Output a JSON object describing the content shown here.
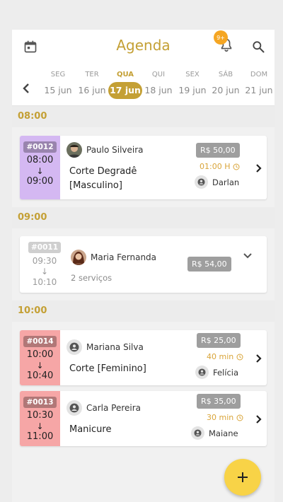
{
  "header": {
    "title": "Agenda",
    "notification_badge": "9+",
    "calendar_icon": "calendar-icon",
    "bell_icon": "bell-icon",
    "search_icon": "search-icon"
  },
  "week": {
    "days": [
      {
        "weekday": "SEG",
        "date": "15 jun"
      },
      {
        "weekday": "TER",
        "date": "16 jun"
      },
      {
        "weekday": "QUA",
        "date": "17 jun"
      },
      {
        "weekday": "QUI",
        "date": "18 jun"
      },
      {
        "weekday": "SEX",
        "date": "19 jun"
      },
      {
        "weekday": "SÁB",
        "date": "20 jun"
      },
      {
        "weekday": "DOM",
        "date": "21 jun"
      }
    ],
    "selected_index": 2
  },
  "slots": [
    "08:00",
    "09:00",
    "10:00"
  ],
  "appointments": [
    {
      "code": "#0012",
      "start": "08:00",
      "end": "09:00",
      "client": "Paulo Silveira",
      "service": "Corte Degradê [Masculino]",
      "price": "R$ 50,00",
      "duration": "01:00 H",
      "professional": "Darlan",
      "color": "#d4b8f2"
    },
    {
      "code": "#0011",
      "start": "09:30",
      "end": "10:10",
      "client": "Maria Fernanda",
      "service": "2 serviços",
      "price": "R$ 54,00"
    },
    {
      "code": "#0014",
      "start": "10:00",
      "end": "10:40",
      "client": "Mariana Silva",
      "service": "Corte [Feminino]",
      "price": "R$ 25,00",
      "duration": "40 min",
      "professional": "Felícia",
      "color": "#f6a6a6"
    },
    {
      "code": "#0013",
      "start": "10:30",
      "end": "11:00",
      "client": "Carla Pereira",
      "service": "Manicure",
      "price": "R$ 35,00",
      "duration": "30 min",
      "professional": "Maiane",
      "color": "#f6a6a6"
    }
  ],
  "colors": {
    "accent": "#c4a035",
    "fab": "#f8d347",
    "duration": "#d9a53a",
    "price_bg": "#9e9e9e"
  },
  "fab": {
    "label": "+"
  }
}
